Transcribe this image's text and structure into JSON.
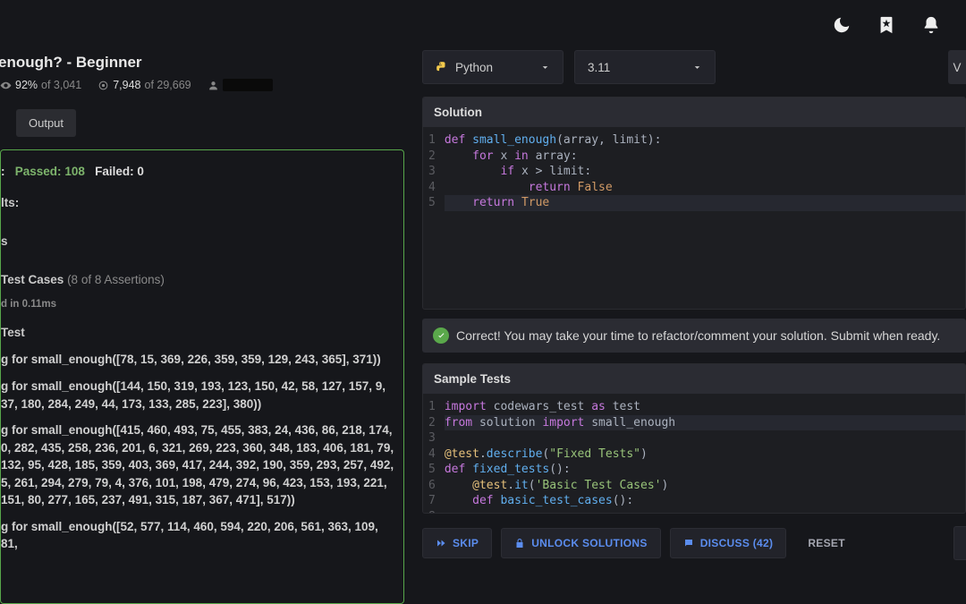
{
  "header": {
    "icons": [
      "moon",
      "bookmark",
      "bell"
    ]
  },
  "kata": {
    "title": "enough? - Beginner",
    "stats": {
      "satisfaction_pct": "92%",
      "satisfaction_of": "of 3,041",
      "completed": "7,948",
      "completed_of": "of 29,669"
    }
  },
  "tabs": {
    "output": "Output"
  },
  "results": {
    "summary_prefix": ":",
    "passed_label": "Passed:",
    "passed_count": "108",
    "failed_label": "Failed:",
    "failed_count": "0",
    "results_label": "lts:",
    "suite_s": "s",
    "test_cases_label": "Test Cases",
    "assertions_note": "(8 of 8 Assertions)",
    "time_note": "d in 0.11ms",
    "test_label": "Test",
    "lines": [
      "g for small_enough([78, 15, 369, 226, 359, 359, 129, 243, 365], 371))",
      "g for small_enough([144, 150, 319, 193, 123, 150, 42, 58, 127, 157, 9, 37, 180, 284, 249, 44, 173, 133, 285, 223], 380))",
      "g for small_enough([415, 460, 493, 75, 455, 383, 24, 436, 86, 218, 174, 0, 282, 435, 258, 236, 201, 6, 321, 269, 223, 360, 348, 183, 406, 181, 79, 132, 95, 428, 185, 359, 403, 369, 417, 244, 392, 190, 359, 293, 257, 492, 5, 261, 294, 279, 79, 4, 376, 101, 198, 479, 274, 96, 423, 153, 193, 221, 151, 80, 277, 165, 237, 491, 315, 187, 367, 471], 517))",
      "g for small_enough([52, 577, 114, 460, 594, 220, 206, 561, 363, 109, 81,"
    ]
  },
  "dropdowns": {
    "language": "Python",
    "version": "3.11",
    "vim_chip": "V"
  },
  "solution": {
    "header": "Solution",
    "lines": [
      [
        {
          "t": "def ",
          "c": "kw"
        },
        {
          "t": "small_enough",
          "c": "fn"
        },
        {
          "t": "(array, limit):",
          "c": "id"
        }
      ],
      [
        {
          "t": "    ",
          "c": "id"
        },
        {
          "t": "for ",
          "c": "kw"
        },
        {
          "t": "x ",
          "c": "id"
        },
        {
          "t": "in ",
          "c": "kw"
        },
        {
          "t": "array:",
          "c": "id"
        }
      ],
      [
        {
          "t": "        ",
          "c": "id"
        },
        {
          "t": "if ",
          "c": "kw"
        },
        {
          "t": "x > limit:",
          "c": "id"
        }
      ],
      [
        {
          "t": "            ",
          "c": "id"
        },
        {
          "t": "return ",
          "c": "kw"
        },
        {
          "t": "False",
          "c": "bool"
        }
      ],
      [
        {
          "t": "    ",
          "c": "id"
        },
        {
          "t": "return ",
          "c": "kw"
        },
        {
          "t": "True",
          "c": "bool"
        }
      ]
    ],
    "highlight_line": 5
  },
  "correct": {
    "message": "Correct! You may take your time to refactor/comment your solution. Submit when ready."
  },
  "tests": {
    "header": "Sample Tests",
    "lines": [
      [
        {
          "t": "import ",
          "c": "kw"
        },
        {
          "t": "codewars_test ",
          "c": "id"
        },
        {
          "t": "as ",
          "c": "kw"
        },
        {
          "t": "test",
          "c": "id"
        }
      ],
      [
        {
          "t": "from ",
          "c": "kw"
        },
        {
          "t": "solution ",
          "c": "id"
        },
        {
          "t": "import ",
          "c": "kw"
        },
        {
          "t": "small_enough",
          "c": "id"
        }
      ],
      [
        {
          "t": "",
          "c": "id"
        }
      ],
      [
        {
          "t": "@test",
          "c": "deco"
        },
        {
          "t": ".",
          "c": "op"
        },
        {
          "t": "describe",
          "c": "fn"
        },
        {
          "t": "(",
          "c": "op"
        },
        {
          "t": "\"Fixed Tests\"",
          "c": "str"
        },
        {
          "t": ")",
          "c": "op"
        }
      ],
      [
        {
          "t": "def ",
          "c": "kw"
        },
        {
          "t": "fixed_tests",
          "c": "fn"
        },
        {
          "t": "():",
          "c": "id"
        }
      ],
      [
        {
          "t": "    @test",
          "c": "deco"
        },
        {
          "t": ".",
          "c": "op"
        },
        {
          "t": "it",
          "c": "fn"
        },
        {
          "t": "(",
          "c": "op"
        },
        {
          "t": "'Basic Test Cases'",
          "c": "str"
        },
        {
          "t": ")",
          "c": "op"
        }
      ],
      [
        {
          "t": "    ",
          "c": "id"
        },
        {
          "t": "def ",
          "c": "kw"
        },
        {
          "t": "basic_test_cases",
          "c": "fn"
        },
        {
          "t": "():",
          "c": "id"
        }
      ],
      [
        {
          "t": "",
          "c": "id"
        }
      ]
    ],
    "highlight_line": 2
  },
  "actions": {
    "skip": "SKIP",
    "unlock": "UNLOCK SOLUTIONS",
    "discuss": "DISCUSS (42)",
    "reset": "RESET"
  }
}
